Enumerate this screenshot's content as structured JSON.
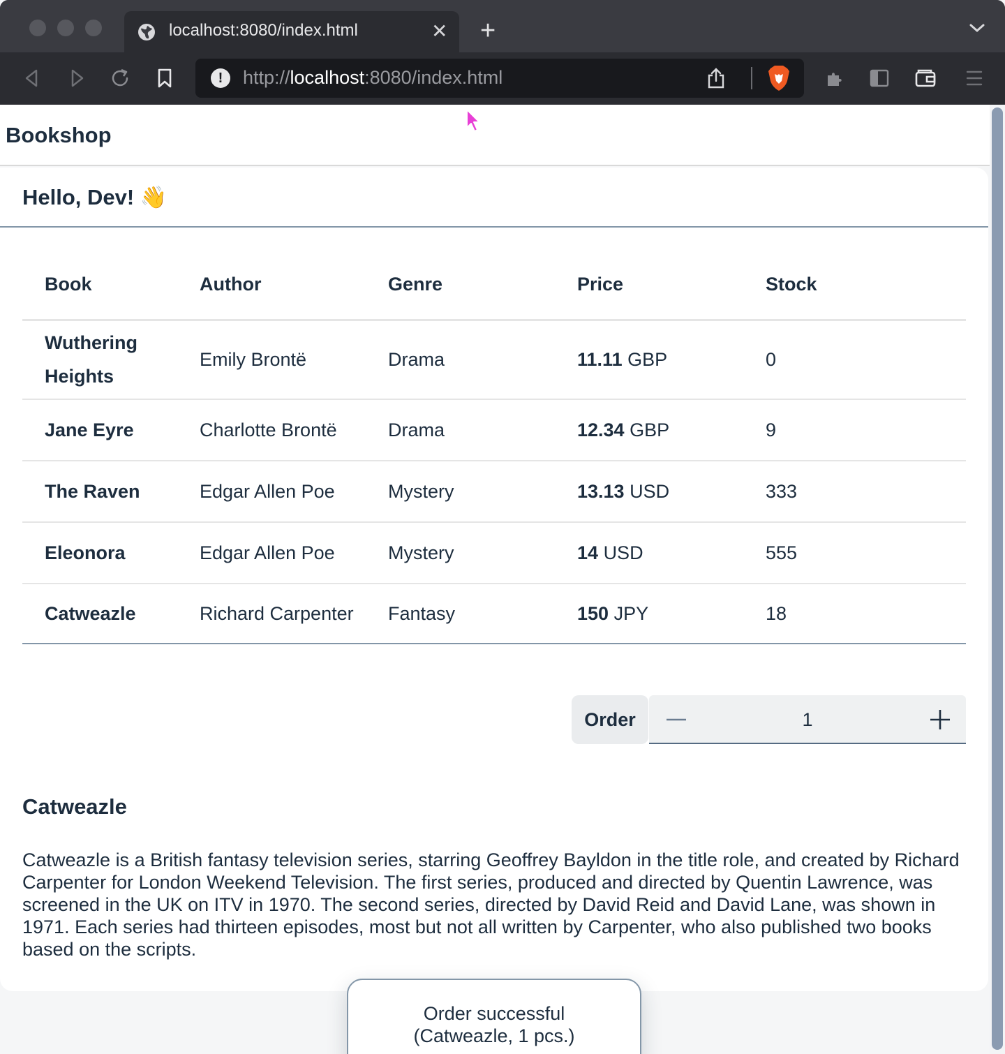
{
  "browser": {
    "tab_title": "localhost:8080/index.html",
    "url_scheme": "http://",
    "url_host": "localhost",
    "url_rest": ":8080/index.html",
    "close_glyph": "✕",
    "newtab_glyph": "+",
    "info_glyph": "!"
  },
  "app": {
    "title": "Bookshop",
    "greeting": "Hello, Dev!",
    "greeting_emoji": "👋"
  },
  "table": {
    "headers": [
      "Book",
      "Author",
      "Genre",
      "Price",
      "Stock"
    ],
    "rows": [
      {
        "title": "Wuthering Heights",
        "author": "Emily Brontë",
        "genre": "Drama",
        "price": "11.11",
        "currency": "GBP",
        "stock": "0"
      },
      {
        "title": "Jane Eyre",
        "author": "Charlotte Brontë",
        "genre": "Drama",
        "price": "12.34",
        "currency": "GBP",
        "stock": "9"
      },
      {
        "title": "The Raven",
        "author": "Edgar Allen Poe",
        "genre": "Mystery",
        "price": "13.13",
        "currency": "USD",
        "stock": "333"
      },
      {
        "title": "Eleonora",
        "author": "Edgar Allen Poe",
        "genre": "Mystery",
        "price": "14",
        "currency": "USD",
        "stock": "555"
      },
      {
        "title": "Catweazle",
        "author": "Richard Carpenter",
        "genre": "Fantasy",
        "price": "150",
        "currency": "JPY",
        "stock": "18"
      }
    ]
  },
  "order": {
    "button_label": "Order",
    "quantity": "1"
  },
  "detail": {
    "title": "Catweazle",
    "text": "Catweazle is a British fantasy television series, starring Geoffrey Bayldon in the title role, and created by Richard Carpenter for London Weekend Television. The first series, produced and directed by Quentin Lawrence, was screened in the UK on ITV in 1970. The second series, directed by David Reid and David Lane, was shown in 1971. Each series had thirteen episodes, most but not all written by Carpenter, who also published two books based on the scripts."
  },
  "toast": {
    "line1": "Order successful",
    "line2": "(Catweazle, 1 pcs.)"
  },
  "colors": {
    "text": "#1d2d3e",
    "accent_border": "#8396a8",
    "chrome_bg": "#2b2c31"
  }
}
